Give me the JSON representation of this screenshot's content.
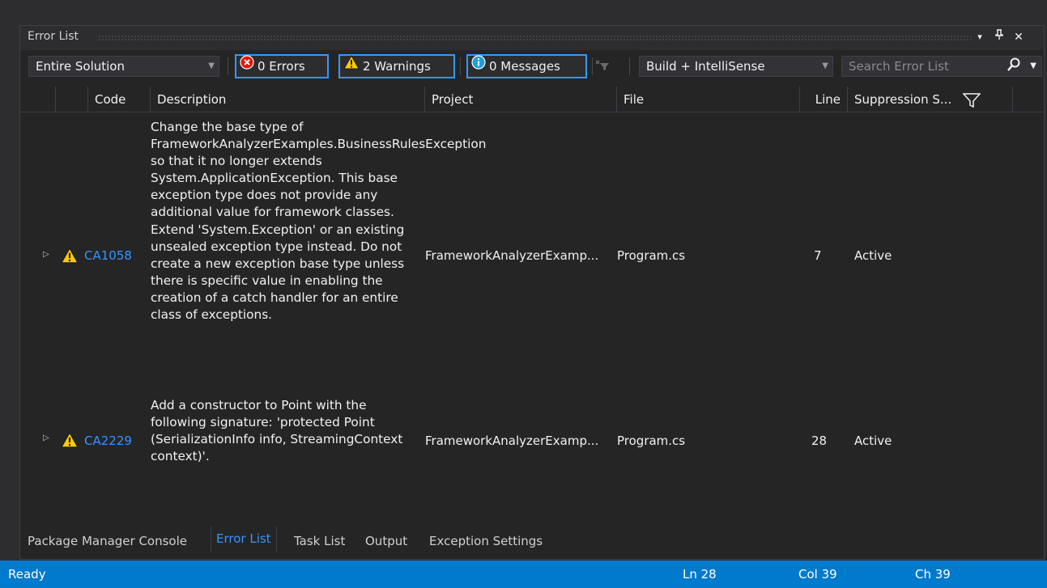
{
  "panel": {
    "title": "Error List",
    "controls": {
      "dropdown": "▾",
      "pin": "⊥",
      "close": "✕"
    }
  },
  "toolbar": {
    "scope": "Entire Solution",
    "errors": "0 Errors",
    "warnings": "2 Warnings",
    "messages": "0 Messages",
    "source": "Build + IntelliSense",
    "search_placeholder": "Search Error List"
  },
  "columns": {
    "code": "Code",
    "description": "Description",
    "project": "Project",
    "file": "File",
    "line": "Line",
    "suppression": "Suppression S..."
  },
  "rows": [
    {
      "code": "CA1058",
      "description": "Change the base type of FrameworkAnalyzerExamples.BusinessRulesException so that it no longer extends System.ApplicationException. This base exception type does not provide any additional value for framework classes. Extend 'System.Exception' or an existing unsealed exception type instead. Do not create a new exception base type unless there is specific value in enabling the creation of a catch handler for an entire class of exceptions.",
      "project": "FrameworkAnalyzerExamp...",
      "file": "Program.cs",
      "line": "7",
      "suppression": "Active"
    },
    {
      "code": "CA2229",
      "description": "Add a constructor to Point with the following signature: 'protected Point (SerializationInfo info, StreamingContext context)'.",
      "project": "FrameworkAnalyzerExamp...",
      "file": "Program.cs",
      "line": "28",
      "suppression": "Active"
    }
  ],
  "tabs": [
    "Package Manager Console",
    "Error List",
    "Task List",
    "Output",
    "Exception Settings"
  ],
  "status": {
    "text": "Ready",
    "ln": "Ln 28",
    "col": "Col 39",
    "ch": "Ch 39"
  },
  "colors": {
    "accent": "#007acc",
    "link": "#3794ff",
    "warning": "#ffcc00",
    "error": "#e51400",
    "info": "#1ba1e2"
  }
}
